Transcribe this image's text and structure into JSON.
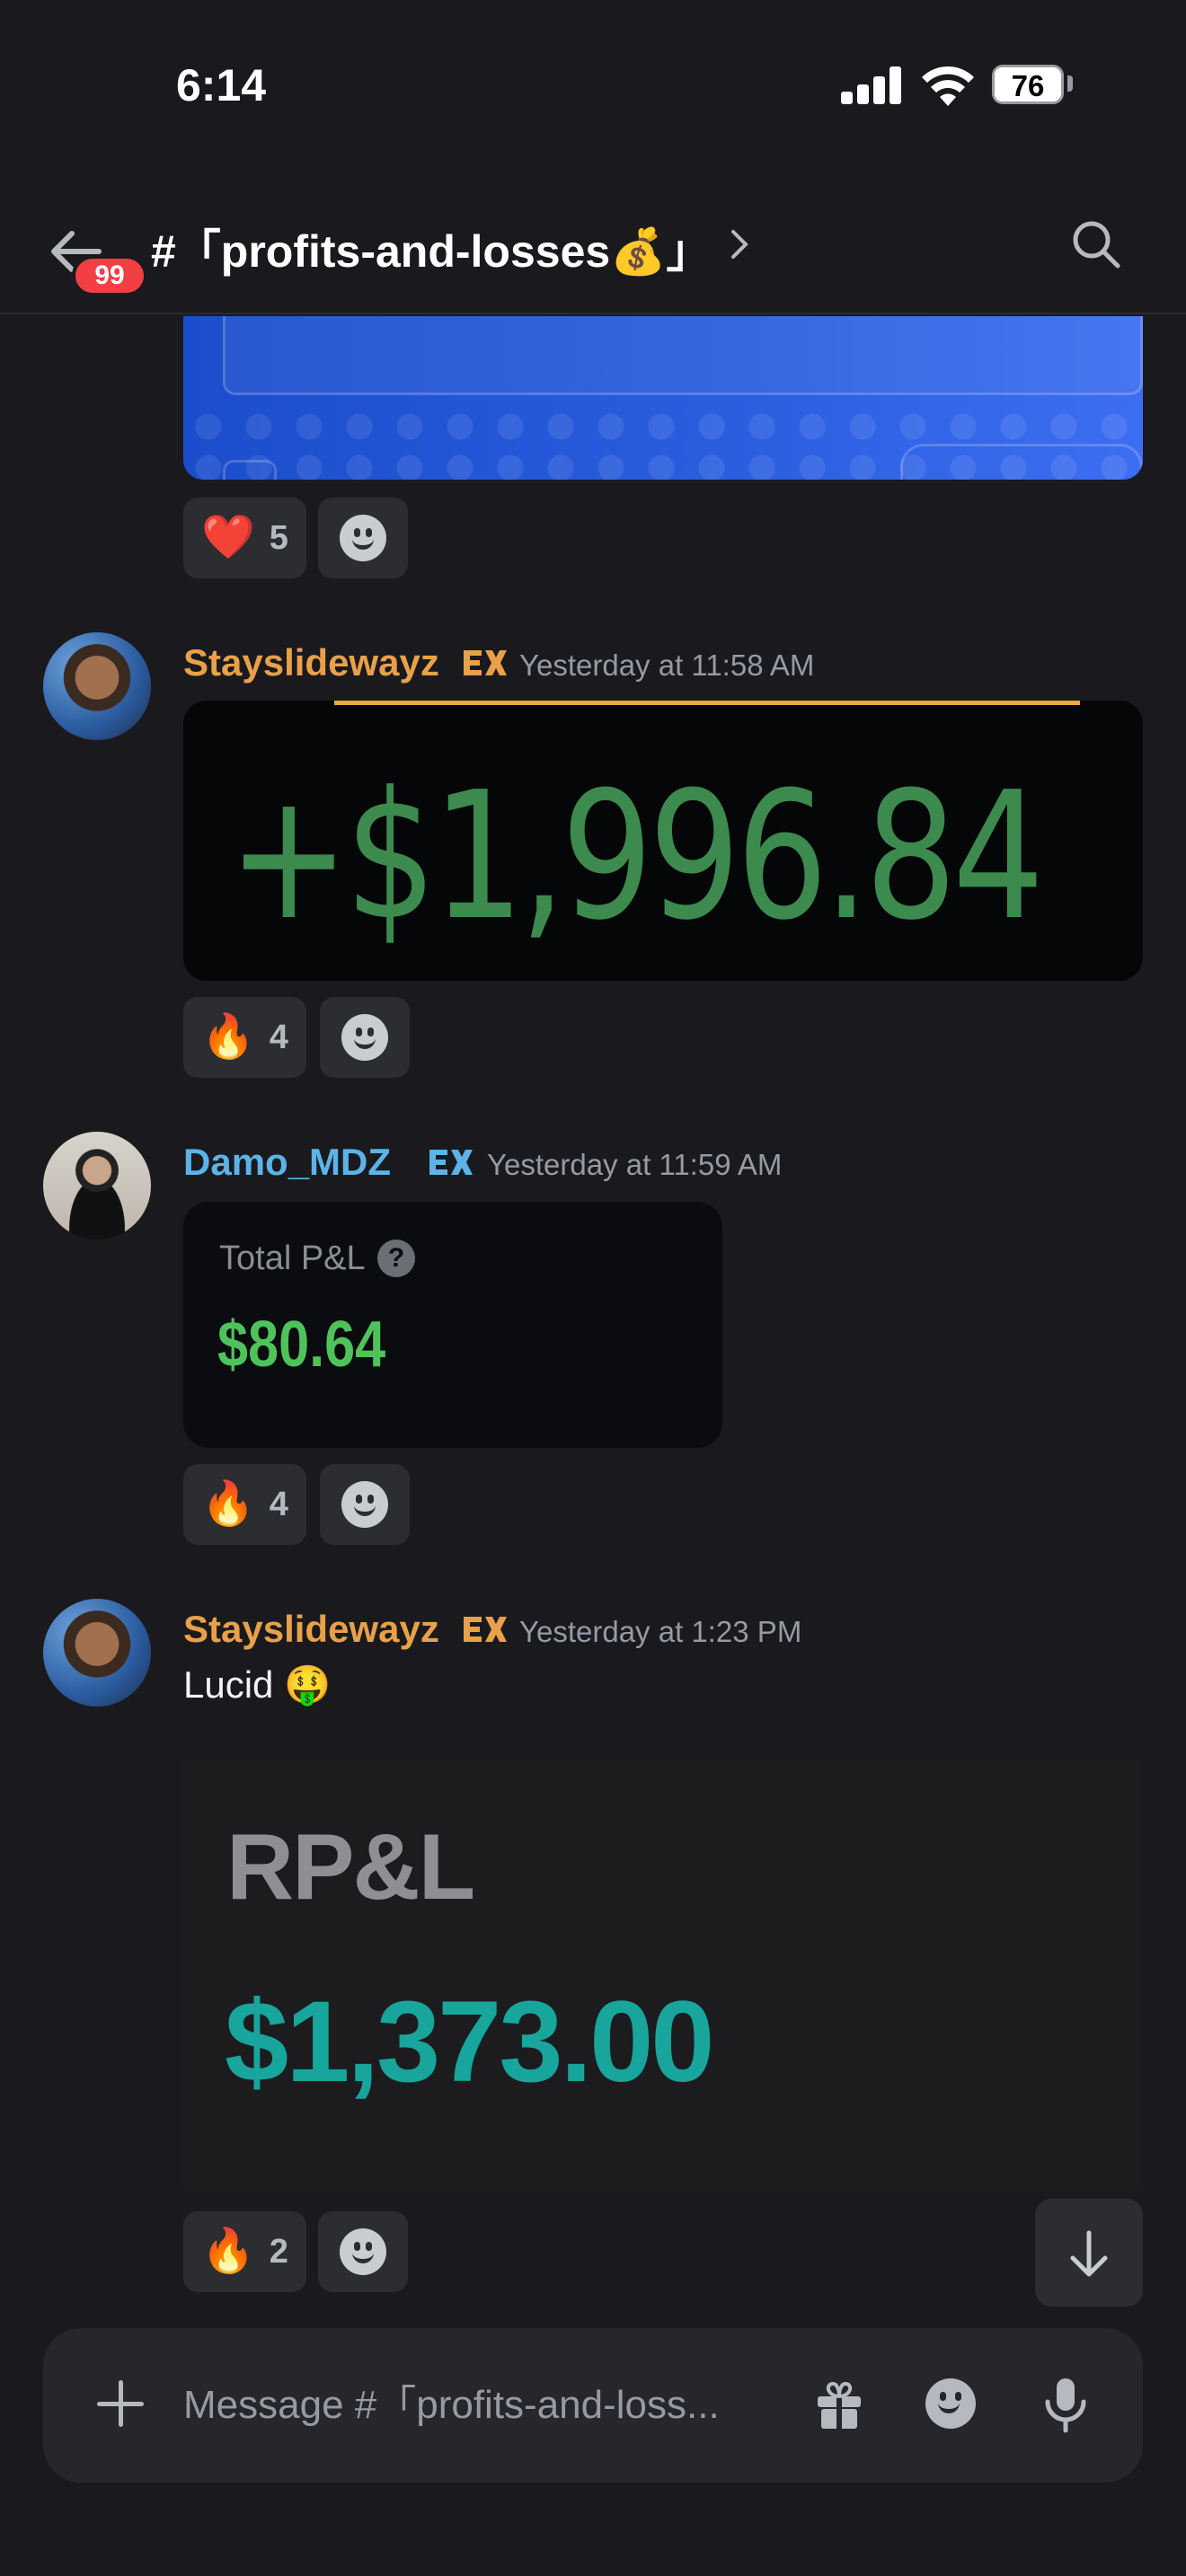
{
  "status_bar": {
    "time": "6:14",
    "battery": "76",
    "battery_level": 0.76
  },
  "header": {
    "unread_badge": "99",
    "channel_name": "#「profits-and-losses💰」"
  },
  "messages": [
    {
      "reactions": [
        {
          "emoji": "❤️",
          "count": "5"
        }
      ]
    },
    {
      "username": "Stayslidewayz",
      "username_color": "#e8a049",
      "timestamp": "Yesterday at 11:58 AM",
      "embed": {
        "amount": "+$1,996.84"
      },
      "reactions": [
        {
          "emoji": "🔥",
          "count": "4"
        }
      ]
    },
    {
      "username": "Damo_MDZ",
      "username_color": "#5bb3e8",
      "timestamp": "Yesterday at 11:59 AM",
      "embed": {
        "label": "Total P&L",
        "help": "?",
        "value": "$80.64"
      },
      "reactions": [
        {
          "emoji": "🔥",
          "count": "4"
        }
      ]
    },
    {
      "username": "Stayslidewayz",
      "username_color": "#e8a049",
      "timestamp": "Yesterday at 1:23 PM",
      "text": "Lucid 🤑",
      "embed": {
        "label": "RP&L",
        "value": "$1,373.00"
      },
      "reactions": [
        {
          "emoji": "🔥",
          "count": "2"
        }
      ]
    }
  ],
  "composer": {
    "placeholder": "Message #「profits-and-loss..."
  },
  "colors": {
    "background": "#1a1a1e",
    "surface": "#2b2d31",
    "badge": "#f23f43"
  }
}
